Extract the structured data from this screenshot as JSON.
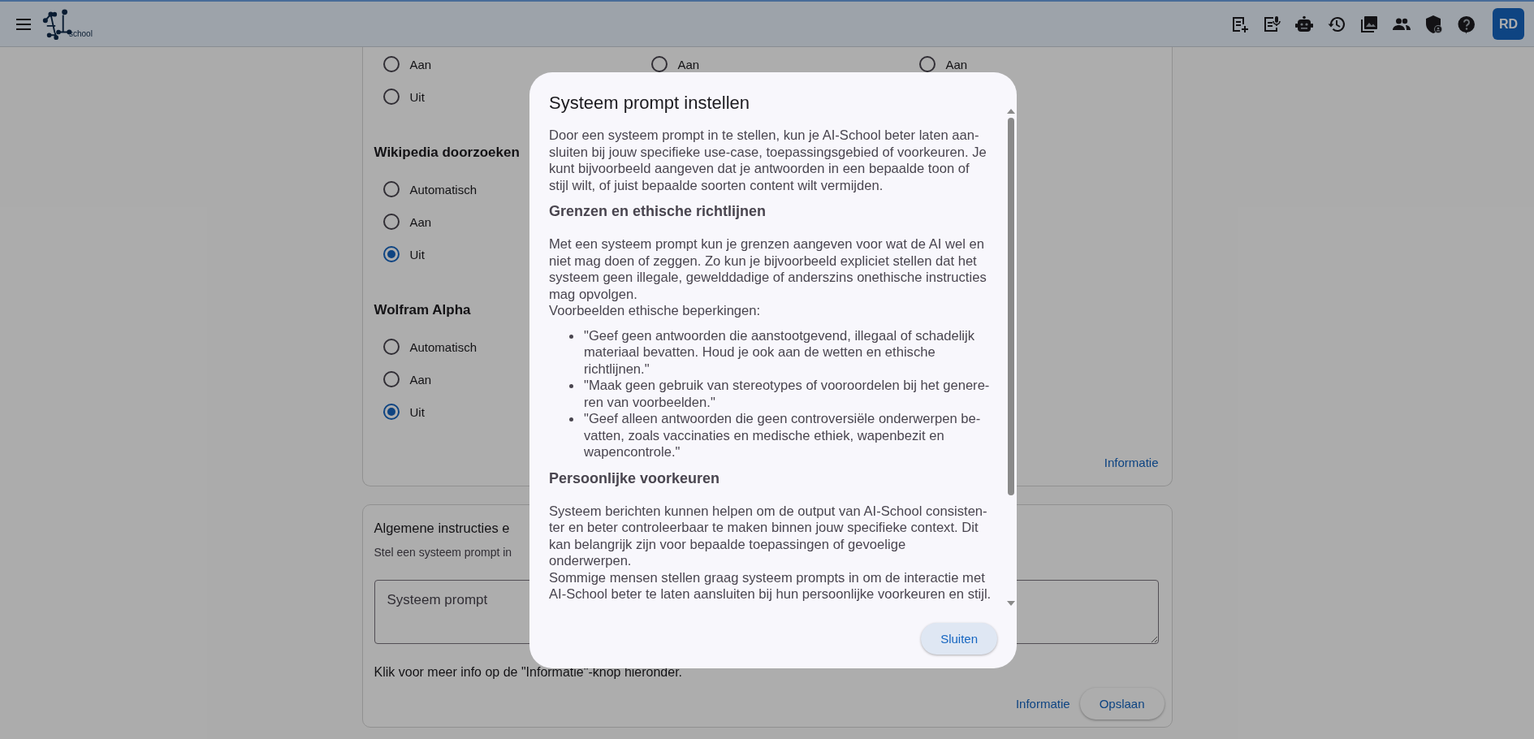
{
  "top_bar": {
    "logo_text": "school",
    "avatar": "RD"
  },
  "settings_card": {
    "top_radio_columns": [
      [
        {
          "label": "Aan",
          "selected": false
        },
        {
          "label": "Uit",
          "selected": false
        }
      ],
      [
        {
          "label": "Aan",
          "selected": false
        }
      ],
      [
        {
          "label": "Aan",
          "selected": false
        }
      ]
    ],
    "groups": [
      {
        "title": "Wikipedia doorzoeken",
        "options": [
          {
            "label": "Automatisch",
            "selected": false
          },
          {
            "label": "Aan",
            "selected": false
          },
          {
            "label": "Uit",
            "selected": true
          }
        ]
      },
      {
        "title": "Wolfram Alpha",
        "options": [
          {
            "label": "Automatisch",
            "selected": false
          },
          {
            "label": "Aan",
            "selected": false
          },
          {
            "label": "Uit",
            "selected": true
          }
        ]
      }
    ],
    "info_link": "Informatie"
  },
  "instructions_card": {
    "title": "Algemene instructies e",
    "subtitle": "Stel een systeem prompt in",
    "textarea": {
      "placeholder": "Systeem prompt"
    },
    "hint": "Klik voor meer info op de \"Informatie\"-knop hieronder.",
    "info_link": "Informatie",
    "save_button": "Opslaan"
  },
  "modal": {
    "title": "Systeem prompt instellen",
    "sections": [
      {
        "kind": "paragraph",
        "lines": [
          "Door een systeem prompt in te stellen, kun je AI-School beter laten aan-",
          "sluiten bij jouw specifieke use-case, toepassingsgebied of voorkeuren. Je",
          "kunt bijvoorbeeld aangeven dat je antwoorden in een bepaalde toon of",
          "stijl wilt, of juist bepaalde soorten content wilt vermijden."
        ]
      },
      {
        "kind": "heading",
        "text": "Grenzen en ethische richtlijnen"
      },
      {
        "kind": "paragraph",
        "lines": [
          "Met een systeem prompt kun je grenzen aangeven voor wat de AI wel en",
          "niet mag doen of zeggen. Zo kun je bijvoorbeeld expliciet stellen dat het",
          "systeem geen illegale, gewelddadige of anderszins onethische instructies",
          "mag opvolgen.",
          "Voorbeelden ethische beperkingen:"
        ]
      },
      {
        "kind": "list",
        "items": [
          {
            "lines": [
              "\"Geef geen antwoorden die aanstootgevend, illegaal of schadelijk",
              "materiaal bevatten. Houd je ook aan de wetten en ethische",
              "richtlijnen.\""
            ]
          },
          {
            "lines": [
              "\"Maak geen gebruik van stereotypes of vooroordelen bij het genere-",
              "ren van voorbeelden.\""
            ]
          },
          {
            "lines": [
              "\"Geef alleen antwoorden die geen controversiële onderwerpen be-",
              "vatten, zoals vaccinaties en medische ethiek, wapenbezit en",
              "wapencontrole.\""
            ]
          }
        ]
      },
      {
        "kind": "heading",
        "text": "Persoonlijke voorkeuren"
      },
      {
        "kind": "paragraph",
        "lines": [
          "Systeem berichten kunnen helpen om de output van AI-School consisten-",
          "ter en beter controleerbaar te maken binnen jouw specifieke context. Dit",
          "kan belangrijk zijn voor bepaalde toepassingen of gevoelige",
          "onderwerpen.",
          "Sommige mensen stellen graag systeem prompts in om de interactie met",
          "AI-School beter te laten aansluiten bij hun persoonlijke voorkeuren en stijl."
        ]
      }
    ],
    "close_button": "Sluiten"
  }
}
